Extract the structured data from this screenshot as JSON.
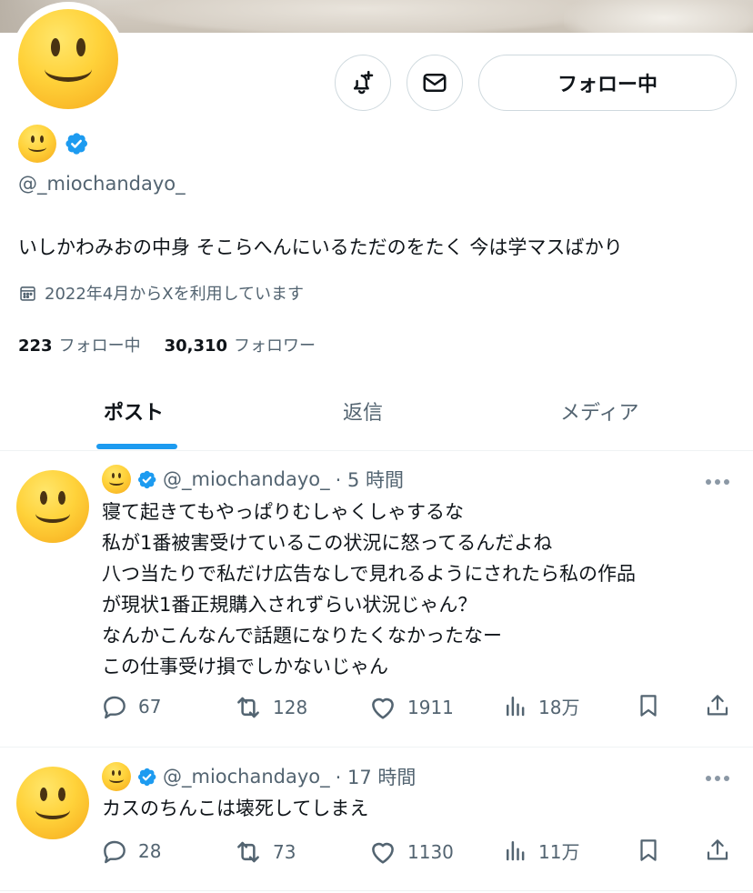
{
  "profile": {
    "display_name_emoji": "smiling-face",
    "handle": "@_miochandayo_",
    "bio": "いしかわみおの中身 そこらへんにいるただのをたく 今は学マスばかり",
    "joined": "2022年4月からXを利用しています",
    "following_count": "223",
    "following_label": "フォロー中",
    "followers_count": "30,310",
    "followers_label": "フォロワー"
  },
  "buttons": {
    "notify_icon": "bell-plus-icon",
    "message_icon": "envelope-icon",
    "follow_label": "フォロー中"
  },
  "tabs": [
    {
      "label": "ポスト",
      "active": true
    },
    {
      "label": "返信",
      "active": false
    },
    {
      "label": "メディア",
      "active": false
    }
  ],
  "tweets": [
    {
      "handle": "@_miochandayo_",
      "time": "· 5 時間",
      "lines": [
        "寝て起きてもやっぱりむしゃくしゃするな",
        "私が1番被害受けているこの状況に怒ってるんだよね",
        "八つ当たりで私だけ広告なしで見れるようにされたら私の作品",
        "が現状1番正規購入されずらい状況じゃん？",
        "なんかこんなんで話題になりたくなかったなー",
        "この仕事受け損でしかないじゃん"
      ],
      "replies": "67",
      "reposts": "128",
      "likes": "1911",
      "views": "18万"
    },
    {
      "handle": "@_miochandayo_",
      "time": "· 17 時間",
      "lines": [
        "カスのちんこは壊死してしまえ"
      ],
      "replies": "28",
      "reposts": "73",
      "likes": "1130",
      "views": "11万"
    }
  ],
  "colors": {
    "accent": "#1d9bf0",
    "text": "#0f1419",
    "muted": "#536471",
    "border": "#cfd9de"
  }
}
